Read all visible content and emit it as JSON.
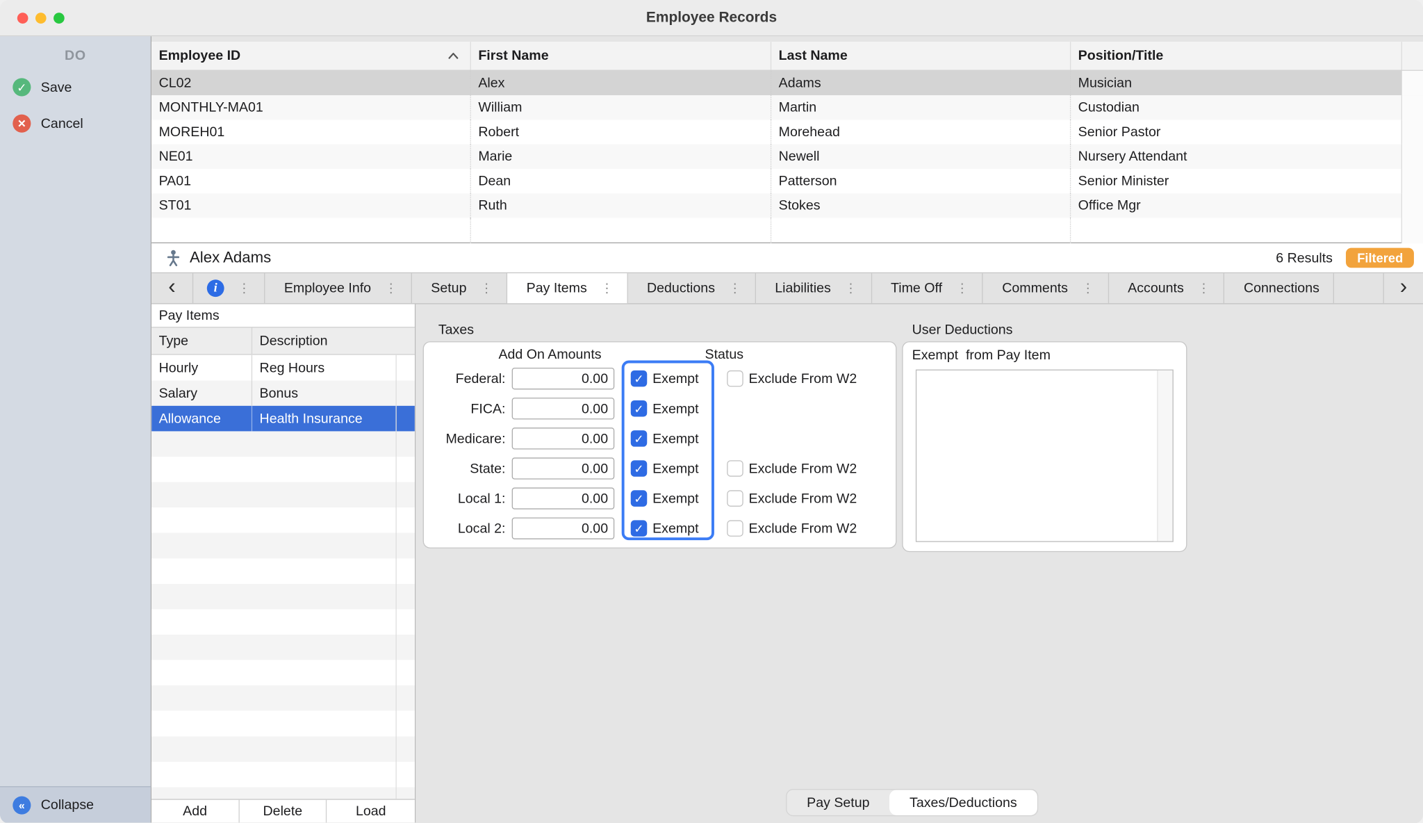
{
  "window": {
    "title": "Employee Records"
  },
  "icons": {
    "check": "✓",
    "cross": "×",
    "collapse": "«",
    "back": "‹",
    "forward": "›",
    "kebab": "⋮",
    "info": "i"
  },
  "sidebar": {
    "header": "DO",
    "actions": [
      {
        "label": "Save"
      },
      {
        "label": "Cancel"
      }
    ],
    "collapse_label": "Collapse"
  },
  "employee_table": {
    "columns": [
      "Employee ID",
      "First Name",
      "Last Name",
      "Position/Title"
    ],
    "sort_column": "Employee ID",
    "sort_direction": "ascending",
    "rows": [
      {
        "id": "CL02",
        "first_name": "Alex",
        "last_name": "Adams",
        "position": "Musician"
      },
      {
        "id": "MONTHLY-MA01",
        "first_name": "William",
        "last_name": "Martin",
        "position": "Custodian"
      },
      {
        "id": "MOREH01",
        "first_name": "Robert",
        "last_name": "Morehead",
        "position": "Senior Pastor"
      },
      {
        "id": "NE01",
        "first_name": "Marie",
        "last_name": "Newell",
        "position": "Nursery Attendant"
      },
      {
        "id": "PA01",
        "first_name": "Dean",
        "last_name": "Patterson",
        "position": "Senior Minister"
      },
      {
        "id": "ST01",
        "first_name": "Ruth",
        "last_name": "Stokes",
        "position": "Office Mgr"
      }
    ]
  },
  "record_bar": {
    "name": "Alex Adams",
    "results": "6 Results",
    "filter_badge": "Filtered",
    "badge_color": "#f2a33c"
  },
  "tabs": {
    "items": [
      "Employee Info",
      "Setup",
      "Pay Items",
      "Deductions",
      "Liabilities",
      "Time Off",
      "Comments",
      "Accounts",
      "Connections"
    ],
    "active": "Pay Items"
  },
  "pay_items": {
    "title": "Pay Items",
    "columns": [
      "Type",
      "Description"
    ],
    "rows": [
      {
        "type": "Hourly",
        "description": "Reg Hours"
      },
      {
        "type": "Salary",
        "description": "Bonus"
      },
      {
        "type": "Allowance",
        "description": "Health Insurance",
        "selected": true
      }
    ],
    "buttons": [
      "Add",
      "Delete",
      "Load"
    ]
  },
  "taxes": {
    "title": "Taxes",
    "col_amounts": "Add On Amounts",
    "col_status": "Status",
    "exempt_label": "Exempt",
    "exclude_label": "Exclude From W2",
    "rows": [
      {
        "label": "Federal:",
        "amount": "0.00",
        "exempt": true,
        "has_exclude": true,
        "exclude_checked": false
      },
      {
        "label": "FICA:",
        "amount": "0.00",
        "exempt": true,
        "has_exclude": false
      },
      {
        "label": "Medicare:",
        "amount": "0.00",
        "exempt": true,
        "has_exclude": false
      },
      {
        "label": "State:",
        "amount": "0.00",
        "exempt": true,
        "has_exclude": true,
        "exclude_checked": false
      },
      {
        "label": "Local 1:",
        "amount": "0.00",
        "exempt": true,
        "has_exclude": true,
        "exclude_checked": false
      },
      {
        "label": "Local 2:",
        "amount": "0.00",
        "exempt": true,
        "has_exclude": true,
        "exclude_checked": false
      }
    ]
  },
  "user_deductions": {
    "title": "User Deductions",
    "subtitle": "Exempt  from Pay Item"
  },
  "bottom_tabs": {
    "items": [
      "Pay Setup",
      "Taxes/Deductions"
    ],
    "active": "Taxes/Deductions"
  },
  "colors": {
    "accent_blue": "#2e6be4",
    "selection_blue": "#3a6fd8",
    "filtered_badge": "#f2a33c",
    "save_green": "#56b87c",
    "cancel_red": "#e2604d"
  }
}
